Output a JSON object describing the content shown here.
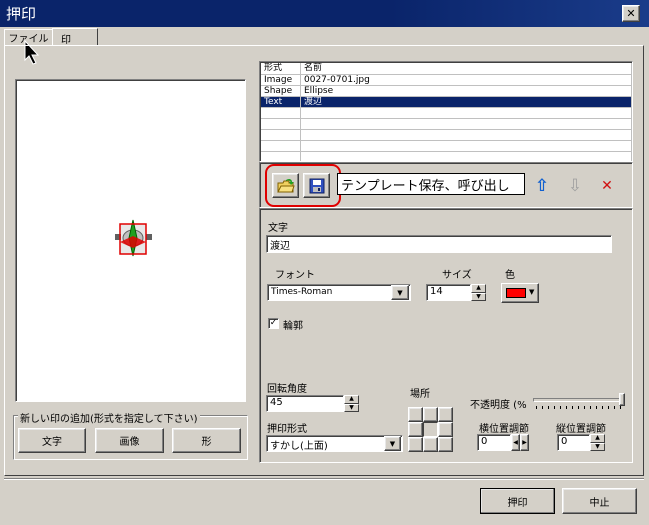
{
  "window": {
    "title": "押印",
    "close_glyph": "✕"
  },
  "tabs": [
    {
      "label": "ファイル"
    },
    {
      "label": "印"
    }
  ],
  "table": {
    "headers": [
      "形式",
      "名前"
    ],
    "rows": [
      [
        "Image",
        "0027-0701.jpg"
      ],
      [
        "Shape",
        "Ellipse"
      ],
      [
        "Text",
        "渡辺"
      ]
    ],
    "selected_row": 2
  },
  "toolbar": {
    "tooltip": "テンプレート保存、呼び出し",
    "up_glyph": "⇧",
    "down_glyph": "⇩",
    "delete_glyph": "✕"
  },
  "props": {
    "text_label": "文字",
    "text_value": "渡辺",
    "font_label": "フォント",
    "font_value": "Times-Roman",
    "size_label": "サイズ",
    "size_value": "14",
    "color_label": "色",
    "color_value": "#ff0000",
    "outline_label": "輪郭",
    "outline_checked": true,
    "rotation_label": "回転角度",
    "rotation_value": "45",
    "stamp_mode_label": "押印形式",
    "stamp_mode_value": "すかし(上面)",
    "location_label": "場所",
    "opacity_label": "不透明度 (%",
    "h_adjust_label": "横位置調節",
    "h_adjust_value": "0",
    "v_adjust_label": "縦位置調節",
    "v_adjust_value": "0"
  },
  "add_group": {
    "label": "新しい印の追加(形式を指定して下さい)",
    "text_button": "文字",
    "image_button": "画像",
    "shape_button": "形"
  },
  "footer": {
    "ok_button": "押印",
    "cancel_button": "中止"
  },
  "colors": {
    "title_bar": "#0a246a",
    "selection": "#0a246a",
    "highlight_ring": "#e00000"
  }
}
